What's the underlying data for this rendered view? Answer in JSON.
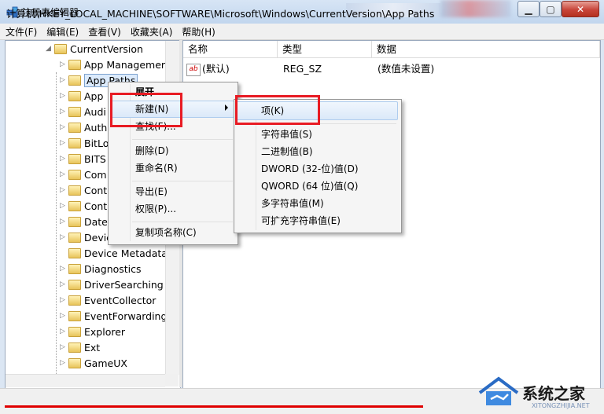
{
  "window": {
    "title": "注册表编辑器",
    "min_glyph": "▁",
    "max_glyph": "▢",
    "close_glyph": "✕"
  },
  "menubar": [
    "文件(F)",
    "编辑(E)",
    "查看(V)",
    "收藏夹(A)",
    "帮助(H)"
  ],
  "tree": {
    "root": "CurrentVersion",
    "items": [
      "App Managemer",
      "App Paths",
      "App",
      "Audi",
      "Auth",
      "BitLo",
      "BITS",
      "Com",
      "Cont",
      "Cont",
      "Date",
      "Devic",
      "Device Metadata",
      "Diagnostics",
      "DriverSearching",
      "EventCollector",
      "EventForwarding",
      "Explorer",
      "Ext",
      "GameUX"
    ]
  },
  "list": {
    "columns": [
      "名称",
      "类型",
      "数据"
    ],
    "rows": [
      {
        "name": "(默认)",
        "type": "REG_SZ",
        "data": "(数值未设置)"
      }
    ]
  },
  "context_menu": {
    "items": [
      "展开",
      "新建(N)",
      "查找(F)...",
      "删除(D)",
      "重命名(R)",
      "导出(E)",
      "权限(P)...",
      "复制项名称(C)"
    ]
  },
  "submenu": {
    "items": [
      "项(K)",
      "字符串值(S)",
      "二进制值(B)",
      "DWORD (32-位)值(D)",
      "QWORD (64 位)值(Q)",
      "多字符串值(M)",
      "可扩充字符串值(E)"
    ]
  },
  "status": {
    "path": "计算机\\HKEY_LOCAL_MACHINE\\SOFTWARE\\Microsoft\\Windows\\CurrentVersion\\App Paths"
  },
  "watermark": {
    "text": "系统之家",
    "sub": "XITONGZHIJIA.NET"
  },
  "icons": {
    "ab": "ab"
  },
  "colors": {
    "annotation_red": "#e81b23",
    "selection": "#dcebfc",
    "menu_highlight": "#aeccee"
  }
}
